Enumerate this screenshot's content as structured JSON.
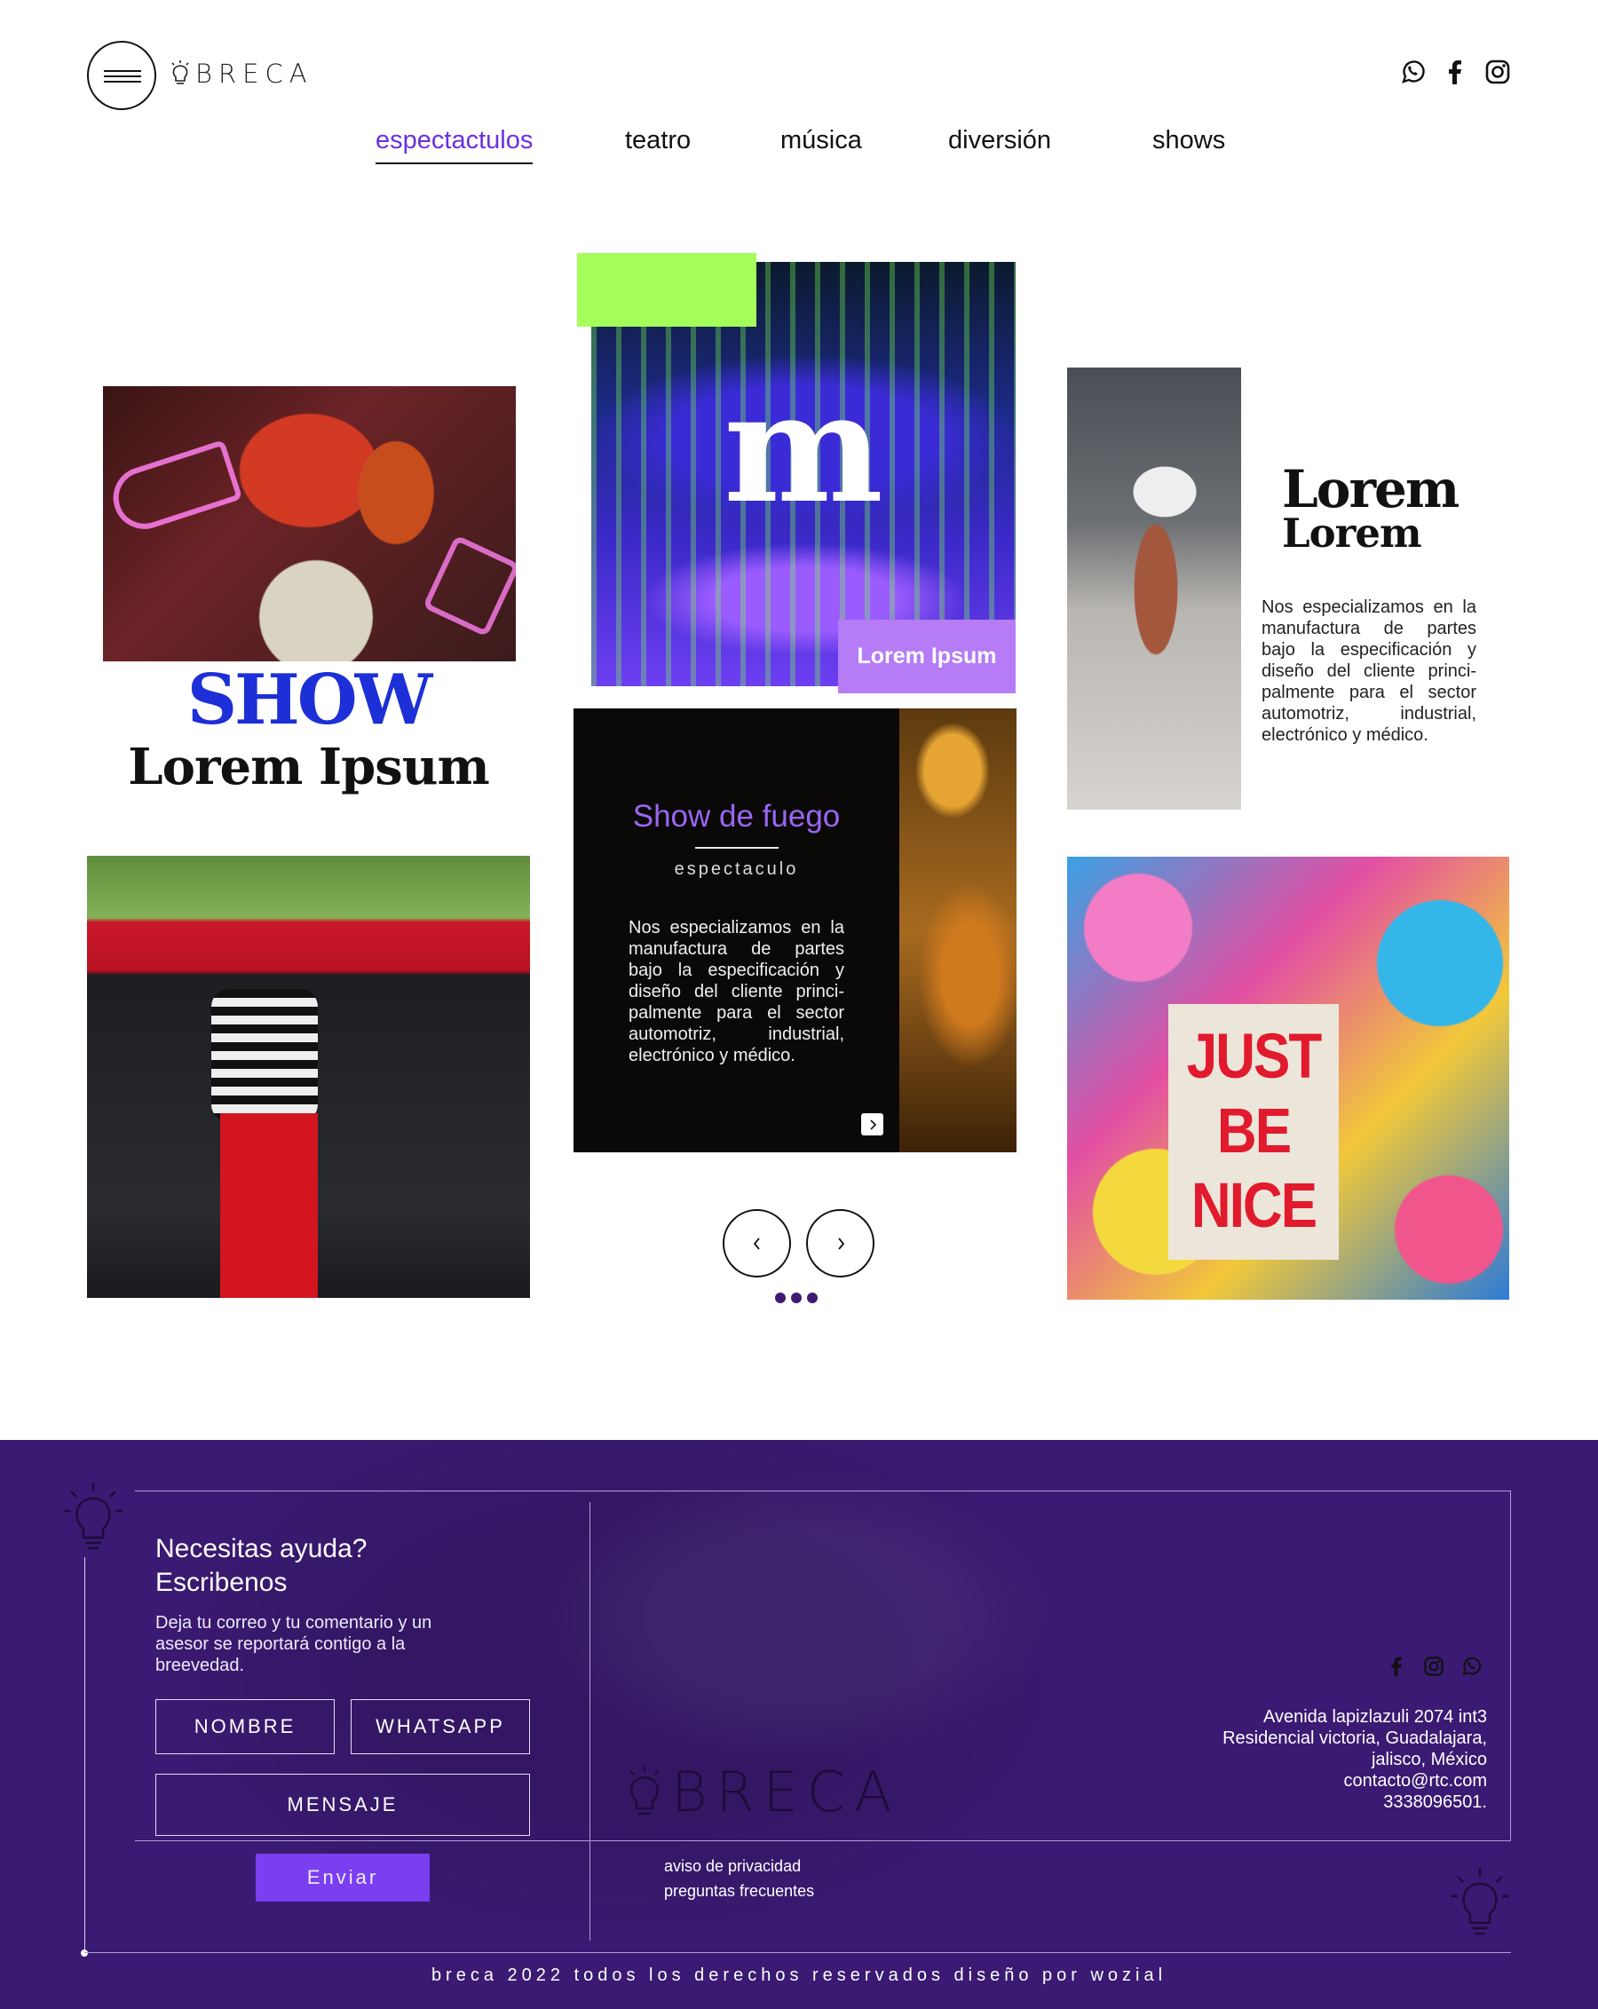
{
  "header": {
    "logo_text": "BRECA",
    "nav": [
      {
        "label": "espectactulos",
        "active": true
      },
      {
        "label": "teatro",
        "active": false
      },
      {
        "label": "música",
        "active": false
      },
      {
        "label": "diversión",
        "active": false
      },
      {
        "label": "shows",
        "active": false
      }
    ],
    "social_icons": [
      "whatsapp-icon",
      "facebook-icon",
      "instagram-icon"
    ]
  },
  "colors": {
    "accent_purple": "#6b2fe0",
    "show_blue": "#1d2fd6",
    "lime": "#a4ff5a",
    "badge_lavender": "#b57cf5",
    "footer_bg": "#3a1a72",
    "button_purple": "#7a3ff0"
  },
  "main": {
    "show_title": "SHOW",
    "show_subtitle": "Lorem Ipsum",
    "card_letter": "m",
    "card_badge": "Lorem Ipsum",
    "fire_card": {
      "title": "Show de fuego",
      "subtitle": "espectaculo",
      "description": "Nos especializamos en la manufactura de partes bajo la especificación y diseño del cliente princi-palmente para el sector automotriz, industrial, electrónico y médico."
    },
    "feature": {
      "title_line1": "Lorem",
      "title_line2": "Lorem",
      "description": "Nos especializamos en la manufactura de partes bajo la especificación y diseño del cliente princi-palmente para el sector automotriz, industrial, electrónico y médico."
    },
    "poster": [
      "JUST",
      "BE",
      "NICE"
    ],
    "carousel": {
      "dots": 3
    }
  },
  "footer": {
    "heading_line1": "Necesitas ayuda?",
    "heading_line2": "Escribenos",
    "description": "Deja tu correo y tu comentario y un asesor se reportará contigo a la breevedad.",
    "form": {
      "name_placeholder": "NOMBRE",
      "whatsapp_placeholder": "WHATSAPP",
      "message_placeholder": "MENSAJE",
      "submit_label": "Enviar"
    },
    "logo_text": "BRECA",
    "social_icons": [
      "facebook-icon",
      "instagram-icon",
      "whatsapp-icon"
    ],
    "address": [
      "Avenida lapizlazuli 2074 int3",
      "Residencial victoria, Guadalajara,",
      "jalisco, México",
      "contacto@rtc.com",
      "3338096501."
    ],
    "links": [
      "aviso de privacidad",
      "preguntas frecuentes"
    ],
    "copyright": "breca 2022 todos los derechos reservados diseño por wozial"
  }
}
